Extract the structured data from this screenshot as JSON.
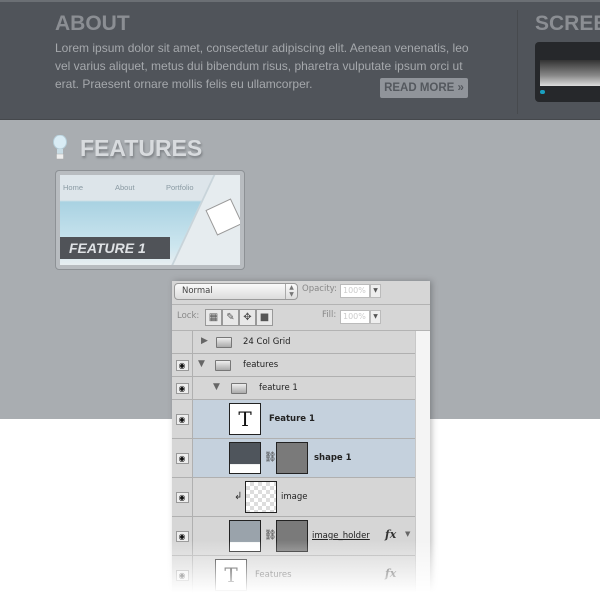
{
  "about": {
    "title": "ABOUT",
    "text": "Lorem ipsum dolor sit amet, consectetur adipiscing elit. Aenean venenatis, leo vel varius aliquet, metus dui bibendum risus, pharetra vulputate ipsum orci ut erat. Praesent ornare mollis felis eu ullamcorper.",
    "read_more": "READ MORE »"
  },
  "screens": {
    "title": "SCREE"
  },
  "features": {
    "title": "FEATURES",
    "icon": "lightbulb-icon",
    "card": {
      "nav": [
        "Home",
        "About",
        "Portfolio"
      ],
      "label": "FEATURE 1"
    }
  },
  "layers_panel": {
    "blend_mode": "Normal",
    "opacity_label": "Opacity:",
    "opacity_value": "100%",
    "lock_label": "Lock:",
    "fill_label": "Fill:",
    "fill_value": "100%",
    "layers": [
      {
        "name": "24 Col Grid",
        "type": "group",
        "visible": false,
        "expanded": false
      },
      {
        "name": "features",
        "type": "group",
        "visible": true,
        "expanded": true
      },
      {
        "name": "feature 1",
        "type": "group",
        "visible": true,
        "expanded": true
      },
      {
        "name": "Feature 1",
        "type": "text",
        "visible": true,
        "selected": true
      },
      {
        "name": "shape 1",
        "type": "shape",
        "visible": true,
        "selected": true
      },
      {
        "name": "image",
        "type": "clipped-image",
        "visible": true
      },
      {
        "name": "image_holder",
        "type": "shape",
        "visible": true,
        "fx": "fx"
      },
      {
        "name": "Features",
        "type": "text",
        "visible": true,
        "fx": "fx"
      }
    ]
  },
  "colors": {
    "header_bg": "#50545a",
    "content_bg": "#a9adb1",
    "selected_layer": "#c5d1dd",
    "panel_bg": "#d6d6d6"
  }
}
